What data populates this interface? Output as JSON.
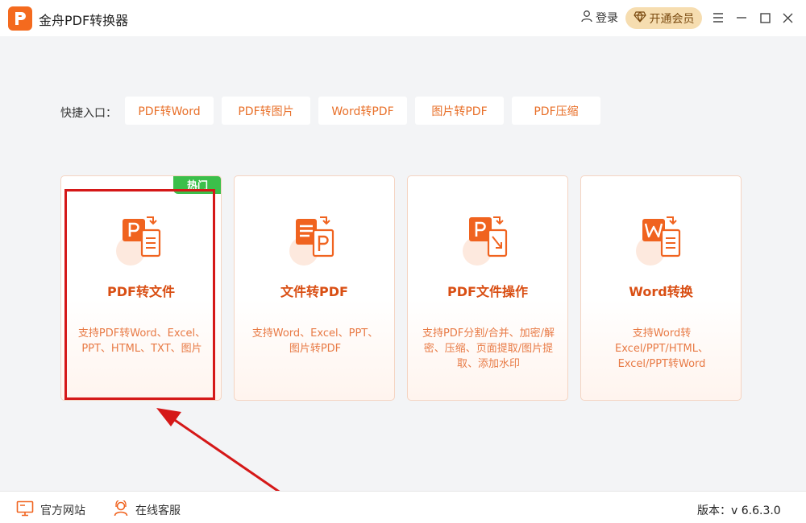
{
  "titlebar": {
    "app_title": "金舟PDF转换器",
    "logo_icon": "app-logo-icon",
    "login_label": "登录",
    "vip_label": "开通会员",
    "accent": "#f46a1e"
  },
  "quick_entry": {
    "label": "快捷入口：",
    "items": [
      {
        "label": "PDF转Word"
      },
      {
        "label": "PDF转图片"
      },
      {
        "label": "Word转PDF"
      },
      {
        "label": "图片转PDF"
      },
      {
        "label": "PDF压缩"
      }
    ]
  },
  "cards": [
    {
      "title": "PDF转文件",
      "desc": "支持PDF转Word、Excel、PPT、HTML、TXT、图片",
      "badge": "热门",
      "icon": "pdf-to-file-icon"
    },
    {
      "title": "文件转PDF",
      "desc": "支持Word、Excel、PPT、图片转PDF",
      "icon": "file-to-pdf-icon"
    },
    {
      "title": "PDF文件操作",
      "desc": "支持PDF分割/合并、加密/解密、压缩、页面提取/图片提取、添加水印",
      "icon": "pdf-operation-icon"
    },
    {
      "title": "Word转换",
      "desc": "支持Word转Excel/PPT/HTML、Excel/PPT转Word",
      "icon": "word-convert-icon"
    }
  ],
  "footer": {
    "website_label": "官方网站",
    "support_label": "在线客服",
    "version_label": "版本：v 6.6.3.0"
  },
  "colors": {
    "primary_orange": "#e8702a",
    "hot_green": "#3bbf4a",
    "annotation_red": "#d51818"
  }
}
